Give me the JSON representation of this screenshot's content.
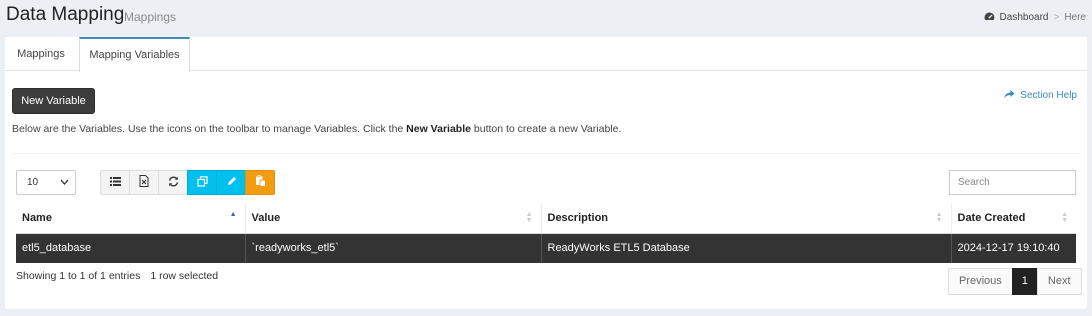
{
  "header": {
    "title": "Data Mapping",
    "subtitle": "Mappings",
    "breadcrumb": {
      "dashboard": "Dashboard",
      "sep": ">",
      "here": "Here"
    }
  },
  "tabs": [
    {
      "label": "Mappings"
    },
    {
      "label": "Mapping Variables"
    }
  ],
  "actions": {
    "new_variable": "New Variable",
    "section_help": "Section Help"
  },
  "description": {
    "before": "Below are the Variables. Use the icons on the toolbar to manage Variables. Click the ",
    "bold": "New Variable",
    "after": " button to create a new Variable."
  },
  "table_controls": {
    "page_length": "10",
    "search_placeholder": "Search"
  },
  "toolbar": [
    {
      "icon": "list-icon"
    },
    {
      "icon": "excel-export-icon"
    },
    {
      "icon": "refresh-icon"
    },
    {
      "icon": "copy-icon"
    },
    {
      "icon": "edit-icon"
    },
    {
      "icon": "paste-icon"
    }
  ],
  "table": {
    "columns": [
      "Name",
      "Value",
      "Description",
      "Date Created"
    ],
    "rows": [
      [
        "etl5_database",
        "`readyworks_etl5`",
        "ReadyWorks ETL5 Database",
        "2024-12-17 19:10:40"
      ]
    ]
  },
  "footer": {
    "info": "Showing 1 to 1 of 1 entries",
    "selected": "1 row selected"
  },
  "pagination": {
    "previous": "Previous",
    "current": "1",
    "next": "Next"
  },
  "colors": {
    "accent": "#3c8dbc",
    "cyan_button": "#00c0ef",
    "orange_button": "#f39c12",
    "selected_row": "#333333"
  }
}
